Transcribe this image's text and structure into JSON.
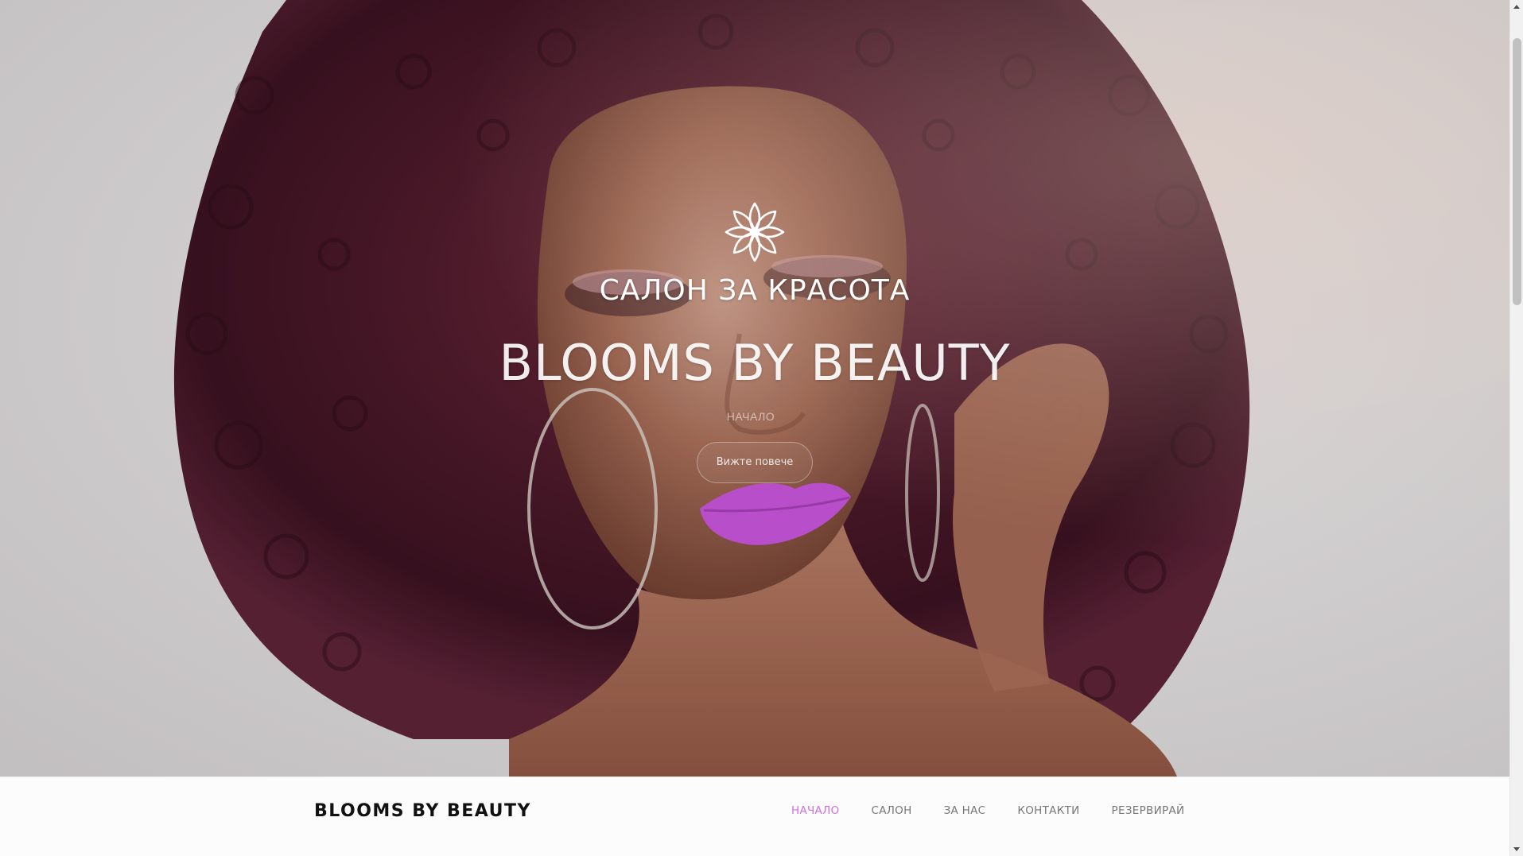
{
  "hero": {
    "subtitle": "САЛОН ЗА КРАСОТА",
    "title": "BLOOMS BY BEAUTY",
    "small_label": "НАЧАЛО",
    "button_label": "Вижте повече",
    "logo_icon": "lotus-flower-icon",
    "photo": "woman-curly-hair-portrait"
  },
  "navbar": {
    "brand": "BLOOMS BY BEAUTY",
    "links": [
      {
        "label": "НАЧАЛО",
        "active": true
      },
      {
        "label": "САЛОН",
        "active": false
      },
      {
        "label": "ЗА НАС",
        "active": false
      },
      {
        "label": "КОНТАКТИ",
        "active": false
      },
      {
        "label": "РЕЗЕРВИРАЙ",
        "active": false
      }
    ]
  },
  "colors": {
    "accent": "#d16fe0",
    "nav_text": "#777777",
    "brand_text": "#111111",
    "hero_text": "#ffffff",
    "hair": "#4a1a2c",
    "lips": "#c553d8"
  }
}
